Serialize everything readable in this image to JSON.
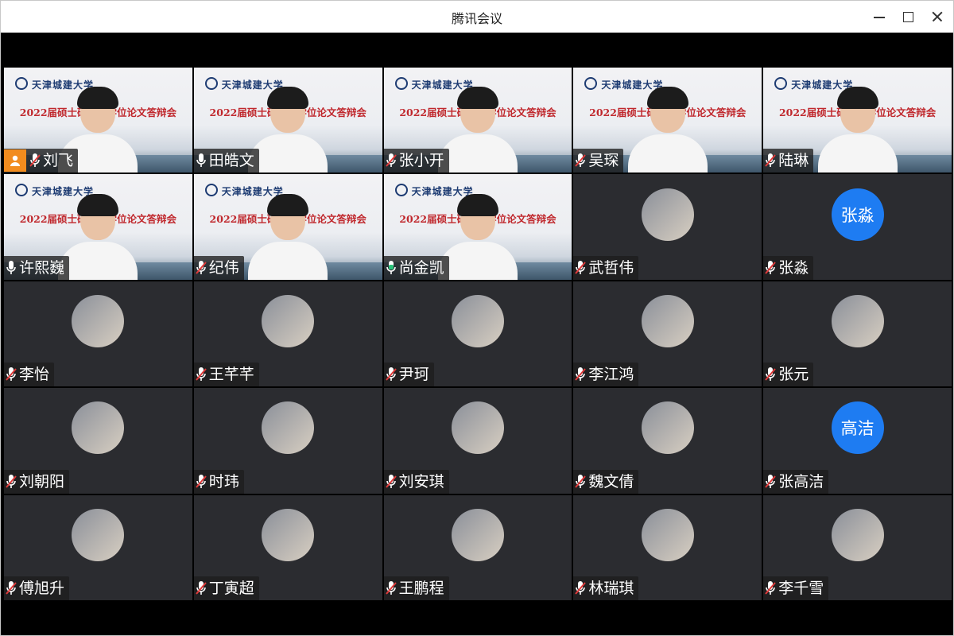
{
  "window": {
    "title": "腾讯会议"
  },
  "banner": {
    "university": "天津城建大学",
    "event": "2022届硕士研究生学位论文答辩会"
  },
  "participants": [
    {
      "name": "刘飞",
      "type": "video",
      "mic": "muted",
      "host": true
    },
    {
      "name": "田皓文",
      "type": "video",
      "mic": "on"
    },
    {
      "name": "张小开",
      "type": "video",
      "mic": "muted"
    },
    {
      "name": "吴琛",
      "type": "video",
      "mic": "muted"
    },
    {
      "name": "陆琳",
      "type": "video",
      "mic": "muted"
    },
    {
      "name": "许熙巍",
      "type": "video",
      "mic": "on"
    },
    {
      "name": "纪伟",
      "type": "video",
      "mic": "muted"
    },
    {
      "name": "尚金凯",
      "type": "video",
      "mic": "speaking",
      "active": true
    },
    {
      "name": "武哲伟",
      "type": "avatar",
      "mic": "muted",
      "avatar_icon": "child-photo-avatar"
    },
    {
      "name": "张淼",
      "type": "avatar-text",
      "mic": "muted",
      "avatar_text": "张淼"
    },
    {
      "name": "李怡",
      "type": "avatar",
      "mic": "muted",
      "avatar_icon": "woman-photo-avatar"
    },
    {
      "name": "王芊芊",
      "type": "avatar",
      "mic": "muted",
      "avatar_icon": "face-photo-avatar"
    },
    {
      "name": "尹珂",
      "type": "avatar",
      "mic": "muted",
      "avatar_icon": "anime-photo-avatar"
    },
    {
      "name": "李江鸿",
      "type": "avatar",
      "mic": "muted",
      "avatar_icon": "cat-photo-avatar"
    },
    {
      "name": "张元",
      "type": "avatar",
      "mic": "muted",
      "avatar_icon": "cartoon-avatar"
    },
    {
      "name": "刘朝阳",
      "type": "avatar",
      "mic": "muted",
      "avatar_icon": "basketball-photo-avatar"
    },
    {
      "name": "时玮",
      "type": "avatar",
      "mic": "muted",
      "avatar_icon": "drawing-avatar"
    },
    {
      "name": "刘安琪",
      "type": "avatar",
      "mic": "muted",
      "avatar_icon": "flowers-photo-avatar"
    },
    {
      "name": "魏文倩",
      "type": "avatar",
      "mic": "muted",
      "avatar_icon": "calligraphy-avatar"
    },
    {
      "name": "张高洁",
      "type": "avatar-text",
      "mic": "muted",
      "avatar_text": "高洁"
    },
    {
      "name": "傅旭升",
      "type": "avatar",
      "mic": "muted",
      "avatar_icon": "flag-photo-avatar"
    },
    {
      "name": "丁寅超",
      "type": "avatar",
      "mic": "muted",
      "avatar_icon": "sign-photo-avatar"
    },
    {
      "name": "王鹏程",
      "type": "avatar",
      "mic": "muted",
      "avatar_icon": "painting-avatar"
    },
    {
      "name": "林瑞琪",
      "type": "avatar",
      "mic": "muted",
      "avatar_icon": "cartoon-cat-avatar"
    },
    {
      "name": "李千雪",
      "type": "avatar",
      "mic": "muted",
      "avatar_icon": "sketch-photo-avatar"
    }
  ],
  "colors": {
    "speaking": "#2ac37a",
    "host": "#f28c1e",
    "avatar_text_bg": "#1e7cf2",
    "tile_bg": "#2b2c30"
  }
}
